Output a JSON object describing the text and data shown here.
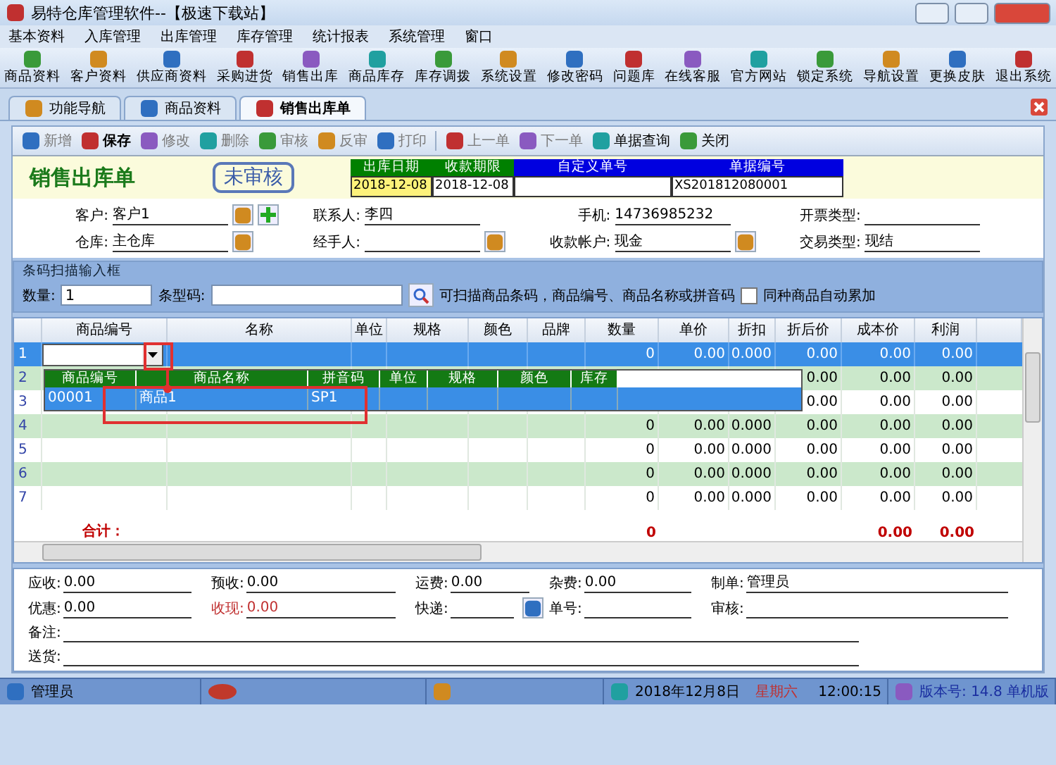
{
  "window": {
    "title": "易特仓库管理软件--【极速下载站】"
  },
  "menu": [
    "基本资料",
    "入库管理",
    "出库管理",
    "库存管理",
    "统计报表",
    "系统管理",
    "窗口"
  ],
  "toolbar": [
    "商品资料",
    "客户资料",
    "供应商资料",
    "采购进货",
    "销售出库",
    "商品库存",
    "库存调拨",
    "系统设置",
    "修改密码",
    "问题库",
    "在线客服",
    "官方网站",
    "锁定系统",
    "导航设置",
    "更换皮肤",
    "退出系统"
  ],
  "tabs": [
    {
      "label": "功能导航",
      "selected": false
    },
    {
      "label": "商品资料",
      "selected": false
    },
    {
      "label": "销售出库单",
      "selected": true
    }
  ],
  "actions": [
    {
      "label": "新增",
      "disabled": true
    },
    {
      "label": "保存",
      "disabled": false
    },
    {
      "label": "修改",
      "disabled": true
    },
    {
      "label": "删除",
      "disabled": true
    },
    {
      "label": "审核",
      "disabled": true
    },
    {
      "label": "反审",
      "disabled": true
    },
    {
      "label": "打印",
      "disabled": true
    },
    {
      "label": "上一单",
      "disabled": true
    },
    {
      "label": "下一单",
      "disabled": true
    },
    {
      "label": "单据查询",
      "disabled": false
    },
    {
      "label": "关闭",
      "disabled": false
    }
  ],
  "form": {
    "title": "销售出库单",
    "status": "未审核",
    "header_fields": [
      {
        "label": "出库日期",
        "color": "#008000",
        "value": "2018-12-08",
        "highlighted": true
      },
      {
        "label": "收款期限",
        "color": "#008000",
        "value": "2018-12-08",
        "highlighted": false
      },
      {
        "label": "自定义单号",
        "color": "#0000e0",
        "highlighted": false
      },
      {
        "label": "单据编号",
        "color": "#0000e0",
        "value": "XS201812080001",
        "highlighted": false
      }
    ],
    "fields": [
      {
        "label": "客户:",
        "value": "客户1",
        "kind": "picker_add"
      },
      {
        "label": "联系人:",
        "value": "李四",
        "kind": "plain"
      },
      {
        "label": "手机:",
        "value": "14736985232",
        "kind": "plain"
      },
      {
        "label": "开票类型:",
        "kind": "plain"
      },
      {
        "label": "仓库:",
        "value": "主仓库",
        "kind": "picker"
      },
      {
        "label": "经手人:",
        "kind": "picker"
      },
      {
        "label": "收款帐户:",
        "value": "现金",
        "kind": "picker"
      },
      {
        "label": "交易类型:",
        "value": "现结",
        "kind": "plain"
      }
    ]
  },
  "barcode": {
    "title": "条码扫描输入框",
    "quantity_label": "数量:",
    "quantity": "1",
    "barcode_label": "条型码:",
    "hint": "可扫描商品条码，商品编号、商品名称或拼音码",
    "auto_add": {
      "label": "同种商品自动累加",
      "checked": false
    }
  },
  "table": {
    "columns": [
      "商品编号",
      "名称",
      "单位",
      "规格",
      "颜色",
      "品牌",
      "数量",
      "单价",
      "折扣",
      "折后价",
      "成本价",
      "利润"
    ],
    "rows": [
      {
        "number": "1",
        "selected": true,
        "quantity": "0",
        "price": "0.00",
        "discount": "0.000",
        "net_price": "0.00",
        "cost": "0.00",
        "profit": "0.00"
      },
      {
        "number": "2",
        "selected": false,
        "net_price": "0.00",
        "cost": "0.00",
        "profit": "0.00"
      },
      {
        "number": "3",
        "selected": false,
        "net_price": "0.00",
        "cost": "0.00",
        "profit": "0.00"
      },
      {
        "number": "4",
        "selected": false,
        "quantity": "0",
        "price": "0.00",
        "discount": "0.000",
        "net_price": "0.00",
        "cost": "0.00",
        "profit": "0.00"
      },
      {
        "number": "5",
        "selected": false,
        "quantity": "0",
        "price": "0.00",
        "discount": "0.000",
        "net_price": "0.00",
        "cost": "0.00",
        "profit": "0.00"
      },
      {
        "number": "6",
        "selected": false,
        "quantity": "0",
        "price": "0.00",
        "discount": "0.000",
        "net_price": "0.00",
        "cost": "0.00",
        "profit": "0.00"
      },
      {
        "number": "7",
        "selected": false,
        "quantity": "0",
        "price": "0.00",
        "discount": "0.000",
        "net_price": "0.00",
        "cost": "0.00",
        "profit": "0.00"
      }
    ],
    "totals": {
      "label": "合计：",
      "quantity": "0",
      "cost": "0.00",
      "profit": "0.00"
    },
    "dropdown": {
      "columns": [
        "商品编号",
        "商品名称",
        "拼音码",
        "单位",
        "规格",
        "颜色",
        "库存"
      ],
      "rows": [
        {
          "cells": [
            "00001",
            "商品1",
            "SP1"
          ],
          "selected": true
        }
      ]
    }
  },
  "summary": [
    {
      "label": "应收:",
      "value": "0.00",
      "emphasis": false
    },
    {
      "label": "预收:",
      "value": "0.00",
      "emphasis": false
    },
    {
      "label": "运费:",
      "value": "0.00",
      "emphasis": false
    },
    {
      "label": "杂费:",
      "value": "0.00",
      "emphasis": false
    },
    {
      "label": "制单:",
      "value": "管理员",
      "emphasis": false
    },
    {
      "label": "优惠:",
      "value": "0.00",
      "emphasis": false
    },
    {
      "label": "收现:",
      "value": "0.00",
      "emphasis": true
    },
    {
      "label": "快递:",
      "emphasis": false
    },
    {
      "label": "单号:",
      "emphasis": false
    },
    {
      "label": "审核:",
      "emphasis": false
    }
  ],
  "notes": [
    {
      "label": "备注:"
    },
    {
      "label": "送货:"
    }
  ],
  "status_bar": {
    "user": "管理员",
    "date": "2018年12月8日",
    "weekday": "星期六",
    "time": "12:00:15",
    "version": "版本号: 14.8 单机版"
  }
}
